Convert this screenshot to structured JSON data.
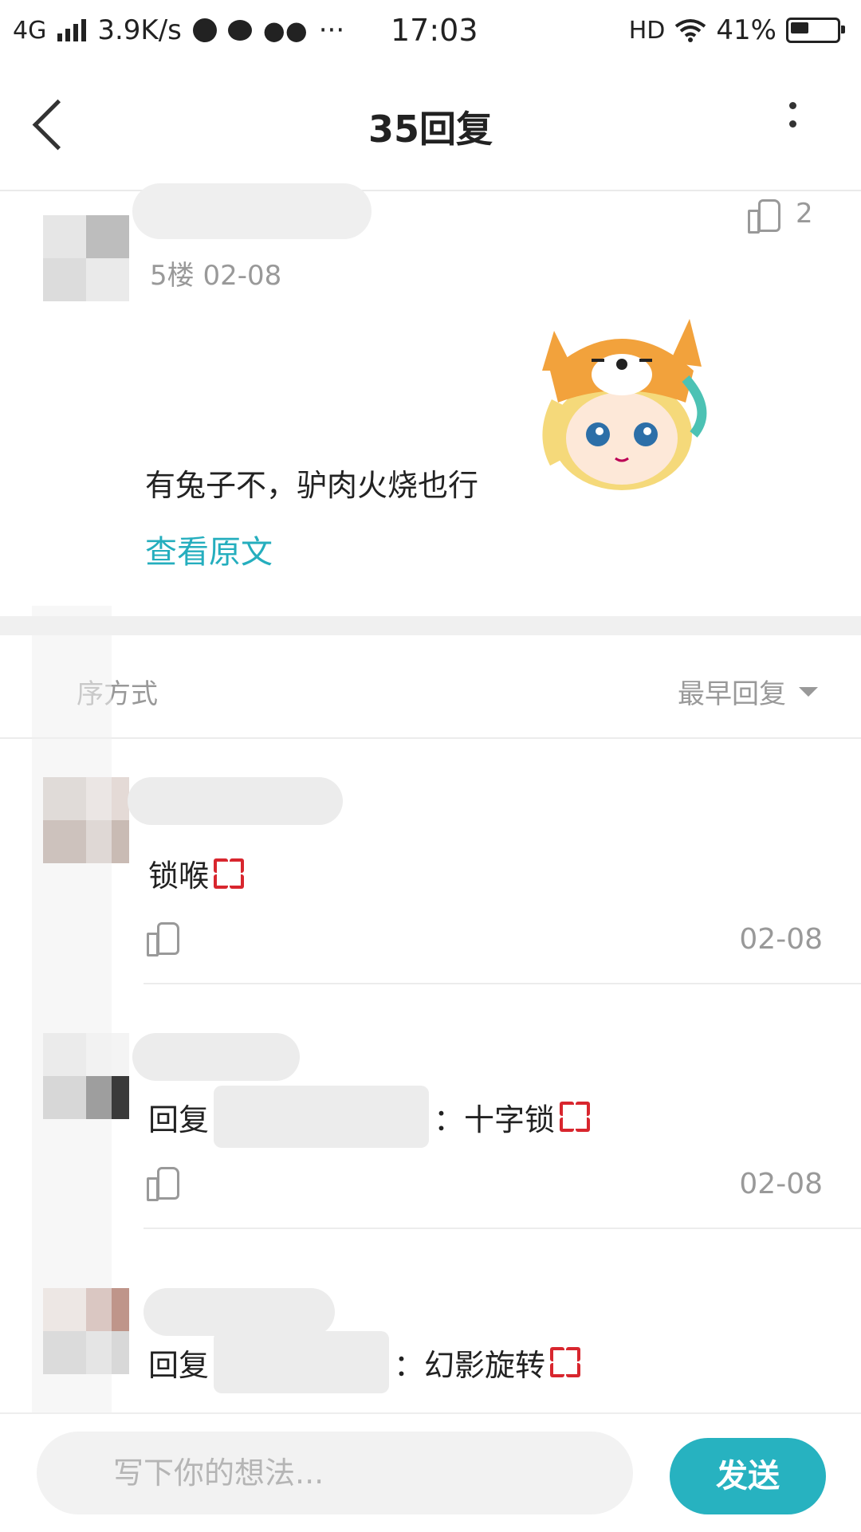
{
  "status_bar": {
    "network": "4G",
    "speed": "3.9K/s",
    "more": "···",
    "time": "17:03",
    "hd": "HD",
    "battery": "41%"
  },
  "nav": {
    "title": "35回复"
  },
  "post": {
    "floor_date": "5楼   02-08",
    "likes": "2",
    "text": "有兔子不，驴肉火烧也行",
    "view_original": "查看原文"
  },
  "sort": {
    "label": "序方式",
    "value": "最早回复"
  },
  "replies": [
    {
      "text": "锁喉",
      "date": "02-08"
    },
    {
      "prefix": "回复",
      "suffix": "：十字锁",
      "date": "02-08"
    },
    {
      "prefix": "回复",
      "suffix": "：幻影旋转"
    }
  ],
  "composer": {
    "placeholder": "写下你的想法...",
    "send": "发送"
  },
  "colors": {
    "accent": "#27b2c0",
    "link": "#25aebe",
    "anger_emoji": "#d8262e"
  }
}
